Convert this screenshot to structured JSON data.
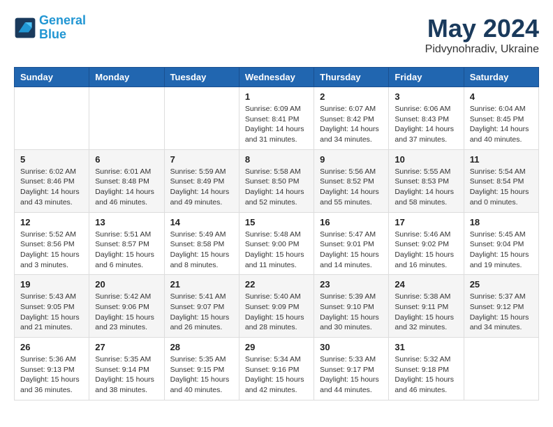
{
  "header": {
    "logo_line1": "General",
    "logo_line2": "Blue",
    "month": "May 2024",
    "location": "Pidvynohradiv, Ukraine"
  },
  "weekdays": [
    "Sunday",
    "Monday",
    "Tuesday",
    "Wednesday",
    "Thursday",
    "Friday",
    "Saturday"
  ],
  "weeks": [
    [
      {
        "day": "",
        "info": ""
      },
      {
        "day": "",
        "info": ""
      },
      {
        "day": "",
        "info": ""
      },
      {
        "day": "1",
        "info": "Sunrise: 6:09 AM\nSunset: 8:41 PM\nDaylight: 14 hours\nand 31 minutes."
      },
      {
        "day": "2",
        "info": "Sunrise: 6:07 AM\nSunset: 8:42 PM\nDaylight: 14 hours\nand 34 minutes."
      },
      {
        "day": "3",
        "info": "Sunrise: 6:06 AM\nSunset: 8:43 PM\nDaylight: 14 hours\nand 37 minutes."
      },
      {
        "day": "4",
        "info": "Sunrise: 6:04 AM\nSunset: 8:45 PM\nDaylight: 14 hours\nand 40 minutes."
      }
    ],
    [
      {
        "day": "5",
        "info": "Sunrise: 6:02 AM\nSunset: 8:46 PM\nDaylight: 14 hours\nand 43 minutes."
      },
      {
        "day": "6",
        "info": "Sunrise: 6:01 AM\nSunset: 8:48 PM\nDaylight: 14 hours\nand 46 minutes."
      },
      {
        "day": "7",
        "info": "Sunrise: 5:59 AM\nSunset: 8:49 PM\nDaylight: 14 hours\nand 49 minutes."
      },
      {
        "day": "8",
        "info": "Sunrise: 5:58 AM\nSunset: 8:50 PM\nDaylight: 14 hours\nand 52 minutes."
      },
      {
        "day": "9",
        "info": "Sunrise: 5:56 AM\nSunset: 8:52 PM\nDaylight: 14 hours\nand 55 minutes."
      },
      {
        "day": "10",
        "info": "Sunrise: 5:55 AM\nSunset: 8:53 PM\nDaylight: 14 hours\nand 58 minutes."
      },
      {
        "day": "11",
        "info": "Sunrise: 5:54 AM\nSunset: 8:54 PM\nDaylight: 15 hours\nand 0 minutes."
      }
    ],
    [
      {
        "day": "12",
        "info": "Sunrise: 5:52 AM\nSunset: 8:56 PM\nDaylight: 15 hours\nand 3 minutes."
      },
      {
        "day": "13",
        "info": "Sunrise: 5:51 AM\nSunset: 8:57 PM\nDaylight: 15 hours\nand 6 minutes."
      },
      {
        "day": "14",
        "info": "Sunrise: 5:49 AM\nSunset: 8:58 PM\nDaylight: 15 hours\nand 8 minutes."
      },
      {
        "day": "15",
        "info": "Sunrise: 5:48 AM\nSunset: 9:00 PM\nDaylight: 15 hours\nand 11 minutes."
      },
      {
        "day": "16",
        "info": "Sunrise: 5:47 AM\nSunset: 9:01 PM\nDaylight: 15 hours\nand 14 minutes."
      },
      {
        "day": "17",
        "info": "Sunrise: 5:46 AM\nSunset: 9:02 PM\nDaylight: 15 hours\nand 16 minutes."
      },
      {
        "day": "18",
        "info": "Sunrise: 5:45 AM\nSunset: 9:04 PM\nDaylight: 15 hours\nand 19 minutes."
      }
    ],
    [
      {
        "day": "19",
        "info": "Sunrise: 5:43 AM\nSunset: 9:05 PM\nDaylight: 15 hours\nand 21 minutes."
      },
      {
        "day": "20",
        "info": "Sunrise: 5:42 AM\nSunset: 9:06 PM\nDaylight: 15 hours\nand 23 minutes."
      },
      {
        "day": "21",
        "info": "Sunrise: 5:41 AM\nSunset: 9:07 PM\nDaylight: 15 hours\nand 26 minutes."
      },
      {
        "day": "22",
        "info": "Sunrise: 5:40 AM\nSunset: 9:09 PM\nDaylight: 15 hours\nand 28 minutes."
      },
      {
        "day": "23",
        "info": "Sunrise: 5:39 AM\nSunset: 9:10 PM\nDaylight: 15 hours\nand 30 minutes."
      },
      {
        "day": "24",
        "info": "Sunrise: 5:38 AM\nSunset: 9:11 PM\nDaylight: 15 hours\nand 32 minutes."
      },
      {
        "day": "25",
        "info": "Sunrise: 5:37 AM\nSunset: 9:12 PM\nDaylight: 15 hours\nand 34 minutes."
      }
    ],
    [
      {
        "day": "26",
        "info": "Sunrise: 5:36 AM\nSunset: 9:13 PM\nDaylight: 15 hours\nand 36 minutes."
      },
      {
        "day": "27",
        "info": "Sunrise: 5:35 AM\nSunset: 9:14 PM\nDaylight: 15 hours\nand 38 minutes."
      },
      {
        "day": "28",
        "info": "Sunrise: 5:35 AM\nSunset: 9:15 PM\nDaylight: 15 hours\nand 40 minutes."
      },
      {
        "day": "29",
        "info": "Sunrise: 5:34 AM\nSunset: 9:16 PM\nDaylight: 15 hours\nand 42 minutes."
      },
      {
        "day": "30",
        "info": "Sunrise: 5:33 AM\nSunset: 9:17 PM\nDaylight: 15 hours\nand 44 minutes."
      },
      {
        "day": "31",
        "info": "Sunrise: 5:32 AM\nSunset: 9:18 PM\nDaylight: 15 hours\nand 46 minutes."
      },
      {
        "day": "",
        "info": ""
      }
    ]
  ]
}
